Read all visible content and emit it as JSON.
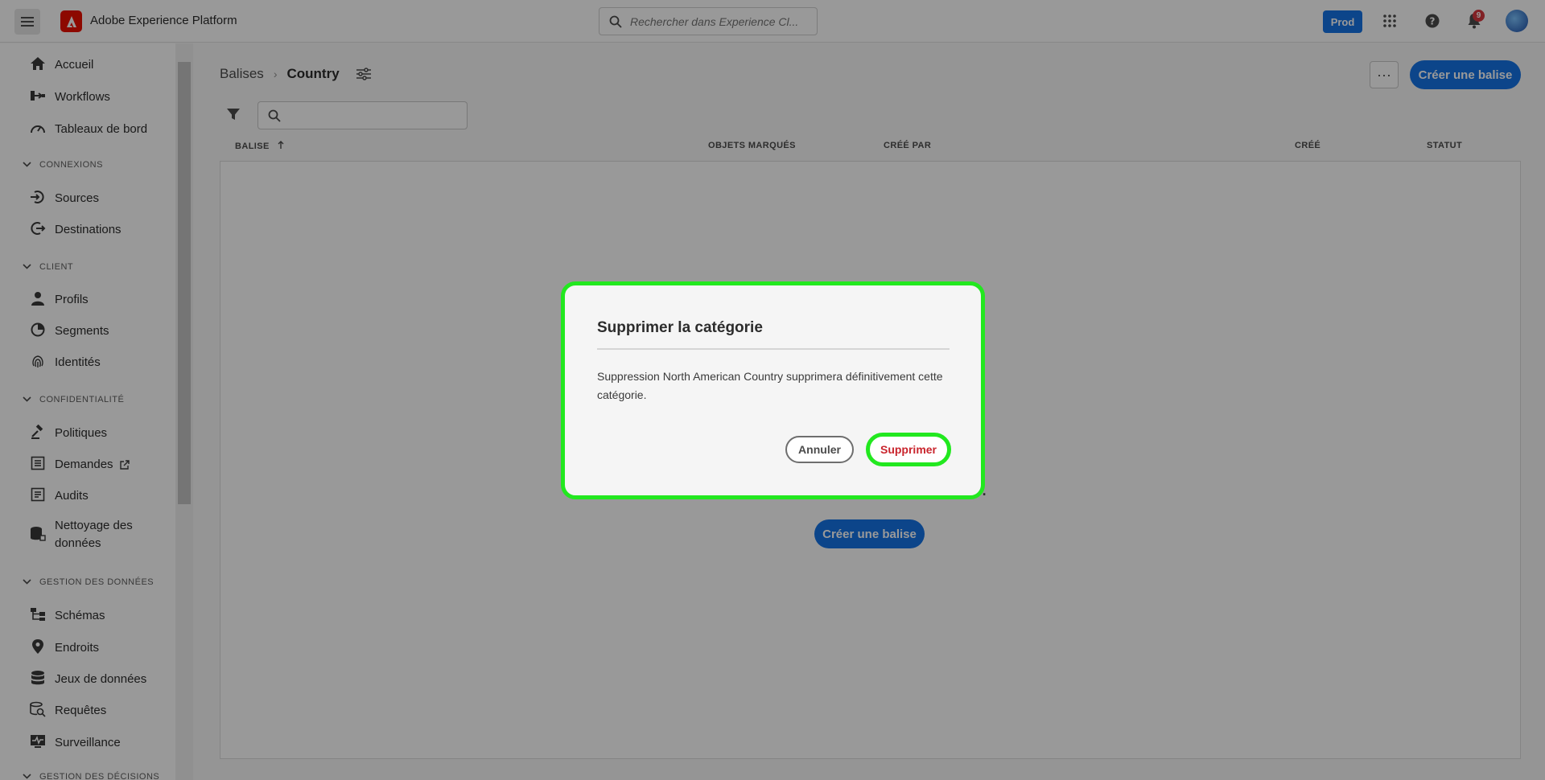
{
  "app": {
    "title": "Adobe Experience Platform",
    "search_placeholder": "Rechercher dans Experience Cl...",
    "environment": "Prod",
    "notification_count": "9"
  },
  "sidebar": {
    "items_top": [
      {
        "label": "Accueil",
        "icon": "home-icon"
      },
      {
        "label": "Workflows",
        "icon": "workflows-icon"
      },
      {
        "label": "Tableaux de bord",
        "icon": "dashboard-icon"
      }
    ],
    "sections": [
      {
        "title": "CONNEXIONS",
        "items": [
          {
            "label": "Sources",
            "icon": "sources-icon"
          },
          {
            "label": "Destinations",
            "icon": "destinations-icon"
          }
        ]
      },
      {
        "title": "CLIENT",
        "items": [
          {
            "label": "Profils",
            "icon": "profile-icon"
          },
          {
            "label": "Segments",
            "icon": "segments-icon"
          },
          {
            "label": "Identités",
            "icon": "fingerprint-icon"
          }
        ]
      },
      {
        "title": "CONFIDENTIALITÉ",
        "items": [
          {
            "label": "Politiques",
            "icon": "gavel-icon"
          },
          {
            "label": "Demandes",
            "icon": "requests-icon"
          },
          {
            "label": "Audits",
            "icon": "audits-icon"
          },
          {
            "label": "Nettoyage des",
            "label2": "données",
            "icon": "data-cleanup-icon"
          }
        ]
      },
      {
        "title": "GESTION DES DONNÉES",
        "items": [
          {
            "label": "Schémas",
            "icon": "schema-icon"
          },
          {
            "label": "Endroits",
            "icon": "location-pin-icon"
          },
          {
            "label": "Jeux de données",
            "icon": "datasets-icon"
          },
          {
            "label": "Requêtes",
            "icon": "queries-icon"
          },
          {
            "label": "Surveillance",
            "icon": "monitoring-icon"
          }
        ]
      },
      {
        "title": "GESTION DES DÉCISIONS",
        "items": []
      }
    ]
  },
  "page": {
    "breadcrumb_root": "Balises",
    "breadcrumb_current": "Country",
    "create_button": "Créer une balise",
    "more_label": "···"
  },
  "table": {
    "columns": [
      "BALISE",
      "OBJETS MARQUÉS",
      "CRÉÉ PAR",
      "CRÉÉ",
      "STATUT"
    ],
    "empty_text_fragment": "e.",
    "empty_create_button": "Créer une balise"
  },
  "dialog": {
    "title": "Supprimer la catégorie",
    "body": "Suppression North American Country supprimera définitivement cette catégorie.",
    "cancel": "Annuler",
    "confirm": "Supprimer"
  },
  "colors": {
    "accent": "#1473e6",
    "highlight": "#22e81f",
    "danger": "#c9252d"
  }
}
